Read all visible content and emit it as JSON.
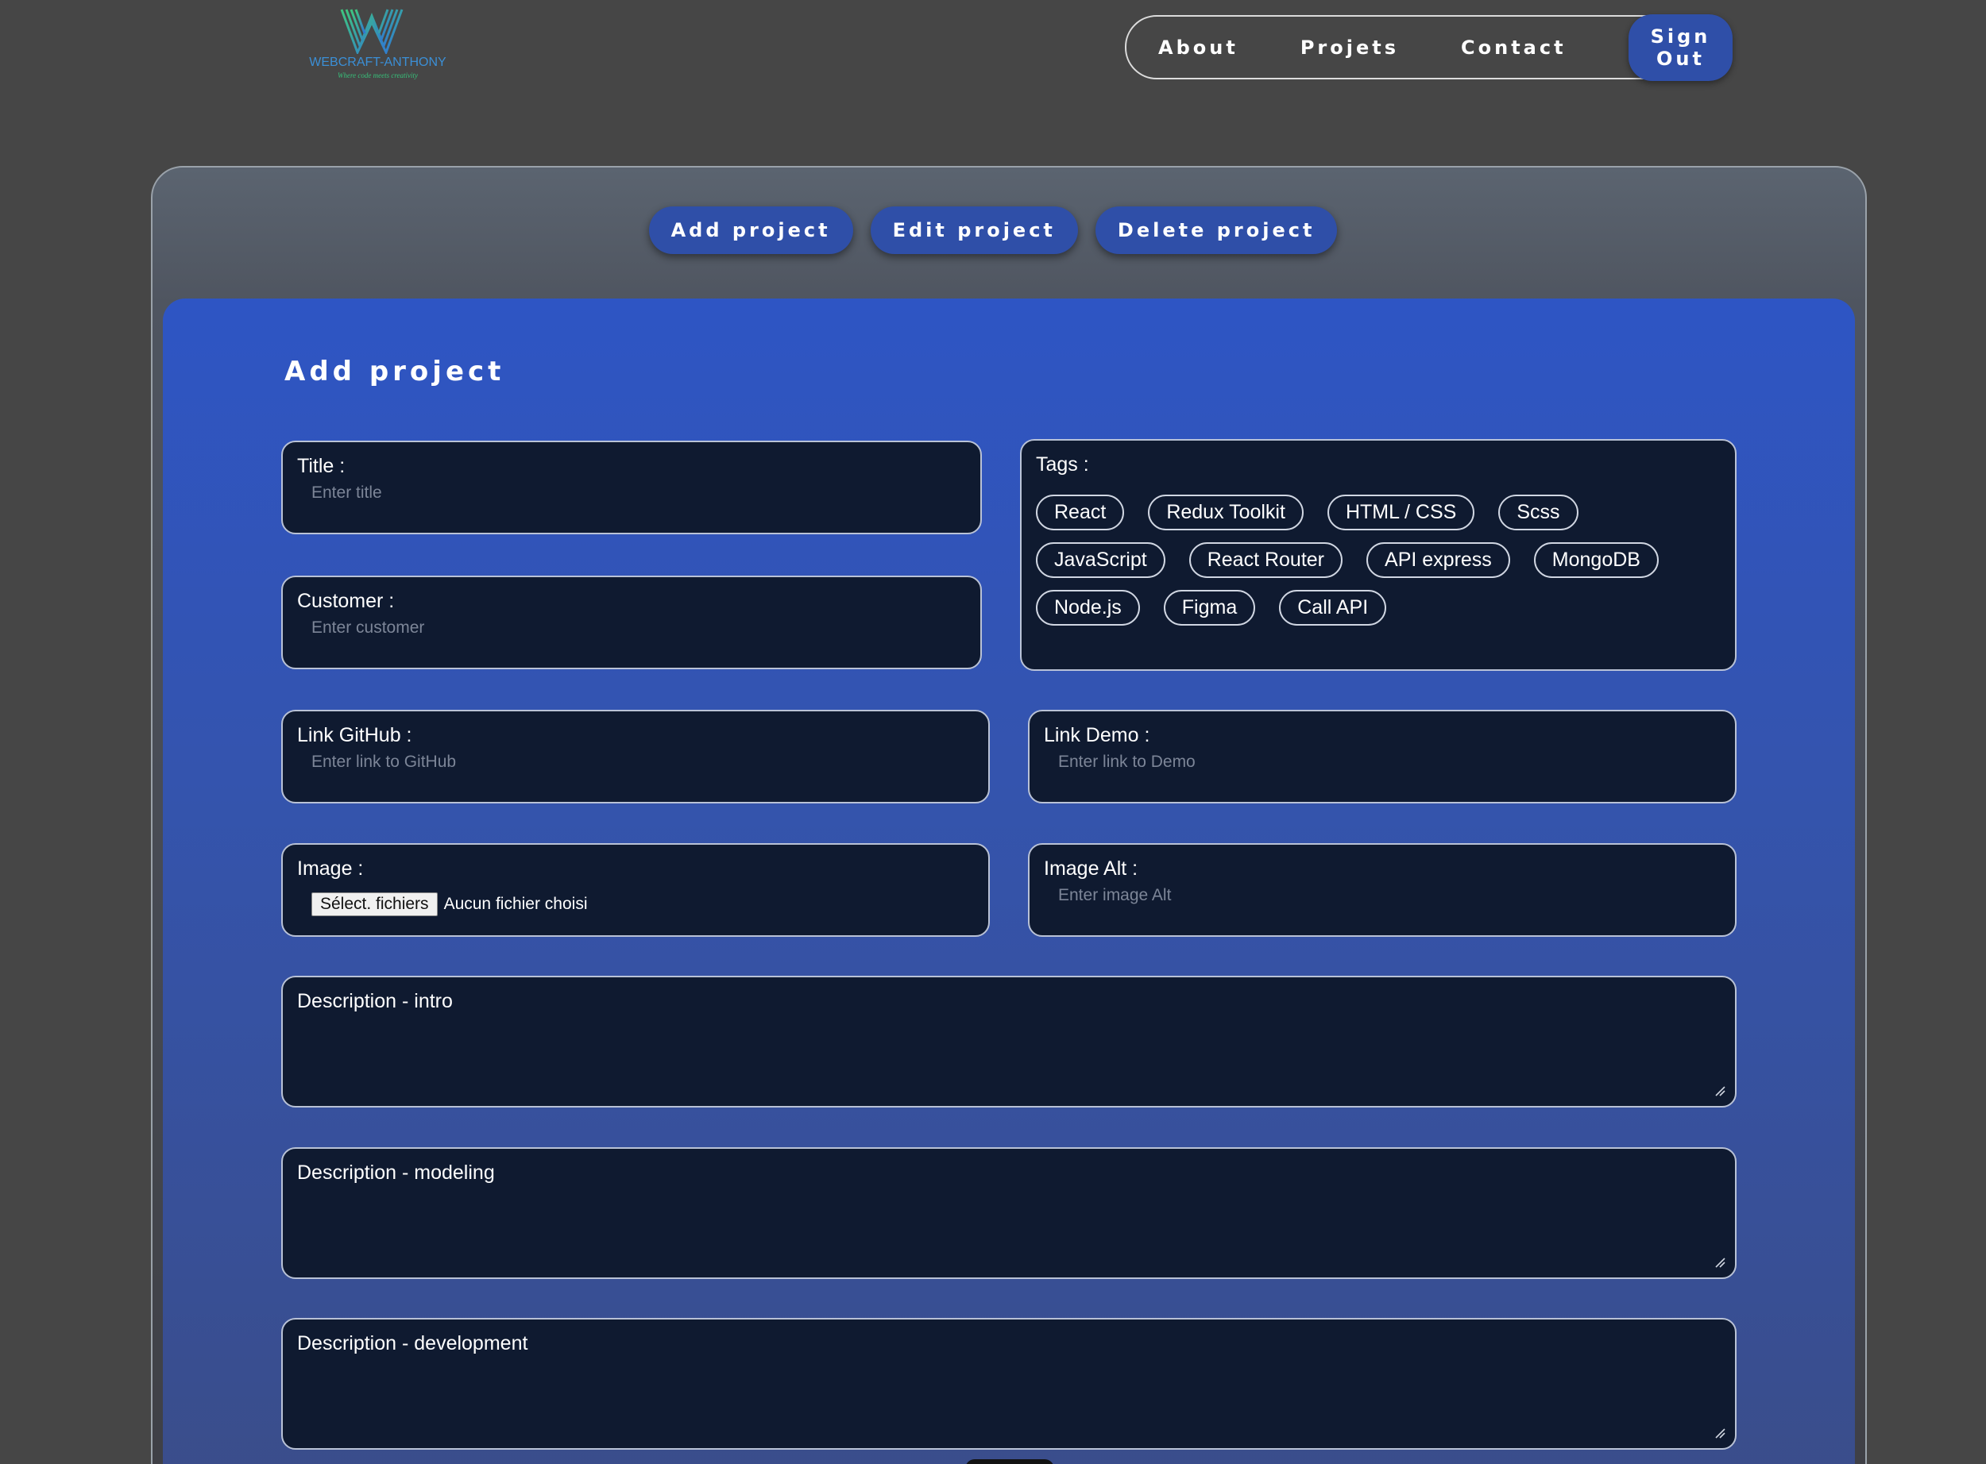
{
  "brand": {
    "name": "WEBCRAFT-ANTHONY",
    "tagline": "Where code meets creativity"
  },
  "nav": {
    "about": "About",
    "projects": "Projets",
    "contact": "Contact",
    "signout": "Sign Out"
  },
  "tabs": {
    "add": "Add project",
    "edit": "Edit project",
    "delete": "Delete project"
  },
  "form": {
    "title": "Add project",
    "fields": {
      "title": {
        "label": "Title :",
        "placeholder": "Enter title"
      },
      "customer": {
        "label": "Customer :",
        "placeholder": "Enter customer"
      },
      "github": {
        "label": "Link GitHub :",
        "placeholder": "Enter link to GitHub"
      },
      "demo": {
        "label": "Link Demo :",
        "placeholder": "Enter link to Demo"
      },
      "image": {
        "label": "Image :",
        "button": "Sélect. fichiers",
        "status": "Aucun fichier choisi"
      },
      "image_alt": {
        "label": "Image Alt :",
        "placeholder": "Enter image Alt"
      },
      "desc_intro": {
        "label": "Description - intro"
      },
      "desc_modeling": {
        "label": "Description - modeling"
      },
      "desc_development": {
        "label": "Description - development"
      }
    },
    "tags": {
      "label": "Tags :",
      "items": [
        "React",
        "Redux Toolkit",
        "HTML / CSS",
        "Scss",
        "JavaScript",
        "React Router",
        "API express",
        "MongoDB",
        "Node.js",
        "Figma",
        "Call API"
      ]
    }
  },
  "colors": {
    "accent": "#2f4fa8",
    "panel": "#2e55c4",
    "field_bg": "#0f1a30",
    "page_bg": "#464646"
  }
}
